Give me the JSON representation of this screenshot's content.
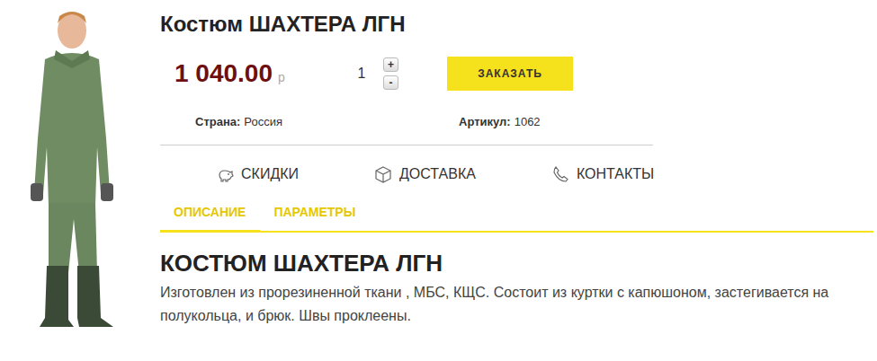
{
  "product": {
    "title": "Костюм ШАХТЕРА ЛГН",
    "price": "1 040.00",
    "currency": "р",
    "quantity": "1",
    "plus": "+",
    "minus": "-",
    "order_button": "ЗАКАЗАТЬ",
    "attributes": [
      {
        "label": "Страна:",
        "value": "Россия"
      },
      {
        "label": "Артикул:",
        "value": "1062"
      }
    ]
  },
  "links": [
    {
      "label": "СКИДКИ",
      "kind": "discounts"
    },
    {
      "label": "ДОСТАВКА",
      "kind": "delivery"
    },
    {
      "label": "КОНТАКТЫ",
      "kind": "contacts"
    }
  ],
  "tabs": [
    {
      "label": "ОПИСАНИЕ",
      "selected": true
    },
    {
      "label": "ПАРАМЕТРЫ",
      "selected": false
    }
  ],
  "description": {
    "heading": "КОСТЮМ ШАХТЕРА ЛГН",
    "text": "Изготовлен из прорезиненной ткани , МБС, КЩС. Состоит из куртки с капюшоном, застегивается на полукольца, и брюк. Швы проклеены."
  }
}
